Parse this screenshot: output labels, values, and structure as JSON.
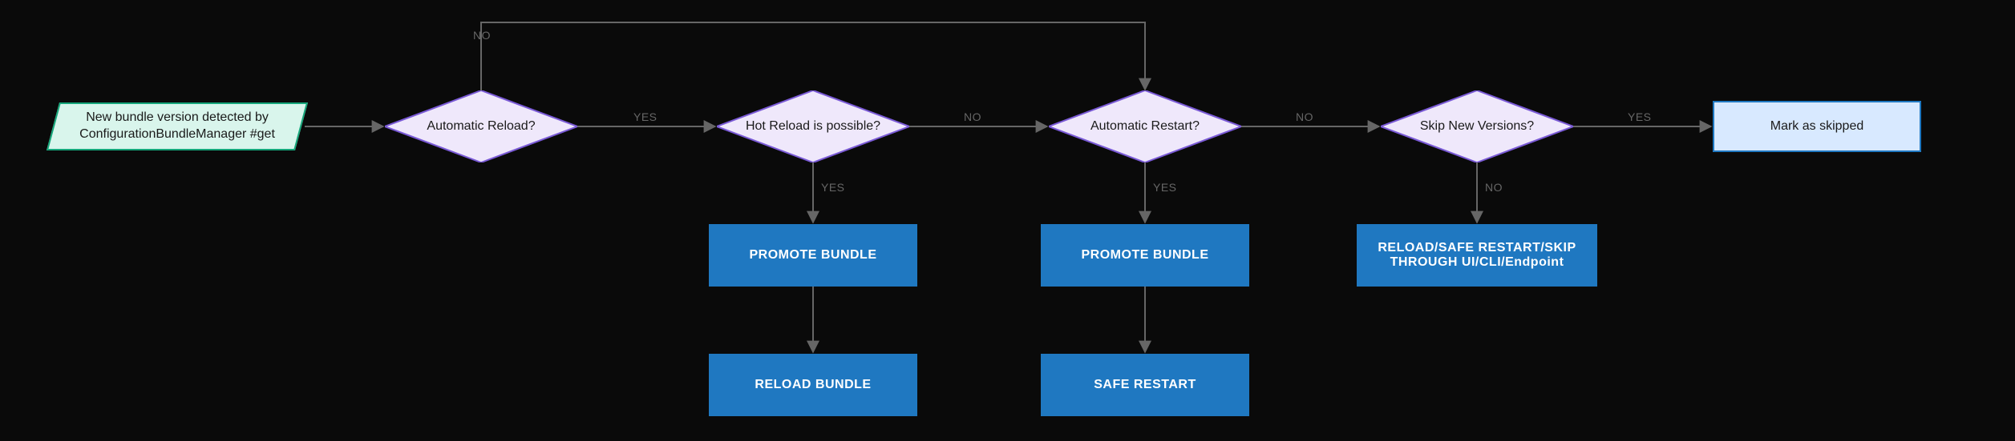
{
  "nodes": {
    "start": "New bundle version detected by ConfigurationBundleManager #get",
    "d1": "Automatic Reload?",
    "d2": "Hot Reload is possible?",
    "d3": "Automatic Restart?",
    "d4": "Skip New Versions?",
    "a1": "PROMOTE BUNDLE",
    "a2": "RELOAD BUNDLE",
    "a3": "PROMOTE BUNDLE",
    "a4": "SAFE RESTART",
    "a5": "RELOAD/SAFE RESTART/SKIP THROUGH UI/CLI/Endpoint",
    "end": "Mark as skipped"
  },
  "labels": {
    "yes": "YES",
    "no": "NO"
  },
  "chart_data": {
    "type": "flowchart",
    "nodes": [
      {
        "id": "start",
        "type": "start",
        "label": "New bundle version detected by ConfigurationBundleManager #get"
      },
      {
        "id": "d1",
        "type": "decision",
        "label": "Automatic Reload?"
      },
      {
        "id": "d2",
        "type": "decision",
        "label": "Hot Reload is possible?"
      },
      {
        "id": "d3",
        "type": "decision",
        "label": "Automatic Restart?"
      },
      {
        "id": "d4",
        "type": "decision",
        "label": "Skip New Versions?"
      },
      {
        "id": "a1",
        "type": "action",
        "label": "PROMOTE BUNDLE"
      },
      {
        "id": "a2",
        "type": "action",
        "label": "RELOAD BUNDLE"
      },
      {
        "id": "a3",
        "type": "action",
        "label": "PROMOTE BUNDLE"
      },
      {
        "id": "a4",
        "type": "action",
        "label": "SAFE RESTART"
      },
      {
        "id": "a5",
        "type": "action",
        "label": "RELOAD/SAFE RESTART/SKIP THROUGH UI/CLI/Endpoint"
      },
      {
        "id": "end",
        "type": "terminator",
        "label": "Mark as skipped"
      }
    ],
    "edges": [
      {
        "from": "start",
        "to": "d1",
        "label": ""
      },
      {
        "from": "d1",
        "to": "d2",
        "label": "YES"
      },
      {
        "from": "d1",
        "to": "d3",
        "label": "NO",
        "routing": "top"
      },
      {
        "from": "d2",
        "to": "a1",
        "label": "YES"
      },
      {
        "from": "a1",
        "to": "a2",
        "label": ""
      },
      {
        "from": "d2",
        "to": "d3",
        "label": "NO"
      },
      {
        "from": "d3",
        "to": "a3",
        "label": "YES"
      },
      {
        "from": "a3",
        "to": "a4",
        "label": ""
      },
      {
        "from": "d3",
        "to": "d4",
        "label": "NO"
      },
      {
        "from": "d4",
        "to": "a5",
        "label": "NO"
      },
      {
        "from": "d4",
        "to": "end",
        "label": "YES"
      }
    ]
  }
}
